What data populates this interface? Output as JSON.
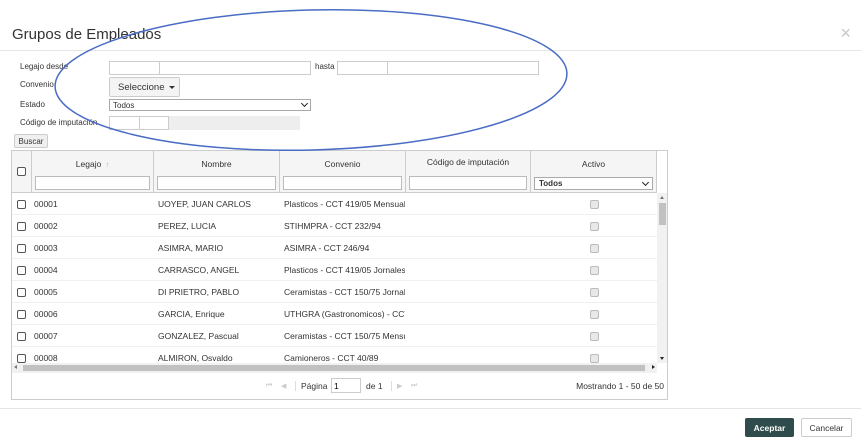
{
  "dialog": {
    "title": "Grupos de Empleados",
    "close_glyph": "×"
  },
  "filters": {
    "legajo_desde_label": "Legajo desde",
    "hasta_label": "hasta",
    "convenio_label": "Convenio",
    "convenio_button": "Seleccione",
    "estado_label": "Estado",
    "estado_value": "Todos",
    "codigo_label": "Código de imputación",
    "codigo_separator": "-",
    "buscar_label": "Buscar"
  },
  "grid": {
    "columns": [
      {
        "label": "Legajo",
        "sort": "ascending"
      },
      {
        "label": "Nombre"
      },
      {
        "label": "Convenio"
      },
      {
        "label": "Código de imputación"
      },
      {
        "label": "Activo"
      }
    ],
    "activo_filter": "Todos",
    "sort_glyph": "↑",
    "rows": [
      {
        "legajo": "00001",
        "nombre": "UOYEP, JUAN CARLOS",
        "convenio": "Plasticos - CCT 419/05 Mensual",
        "activo": true
      },
      {
        "legajo": "00002",
        "nombre": "PEREZ, LUCIA",
        "convenio": "STIHMPRA - CCT 232/94",
        "activo": true
      },
      {
        "legajo": "00003",
        "nombre": "ASIMRA, MARIO",
        "convenio": "ASIMRA - CCT 246/94",
        "activo": true
      },
      {
        "legajo": "00004",
        "nombre": "CARRASCO, ANGEL",
        "convenio": "Plasticos - CCT 419/05 Jornales",
        "activo": true
      },
      {
        "legajo": "00005",
        "nombre": "DI PRIETRO, PABLO",
        "convenio": "Ceramistas - CCT 150/75 Jornal",
        "activo": true
      },
      {
        "legajo": "00006",
        "nombre": "GARCIA, Enrique",
        "convenio": "UTHGRA (Gastronomicos) - CCT",
        "activo": true
      },
      {
        "legajo": "00007",
        "nombre": "GONZALEZ, Pascual",
        "convenio": "Ceramistas - CCT 150/75 Mensu",
        "activo": true
      },
      {
        "legajo": "00008",
        "nombre": "ALMIRON, Osvaldo",
        "convenio": "Camioneros - CCT 40/89",
        "activo": true
      }
    ],
    "pager": {
      "page_label": "Página",
      "page_value": "1",
      "of_label": "de 1",
      "summary": "Mostrando 1 - 50 de 50",
      "first_glyph": "⏮",
      "prev_glyph": "◀",
      "next_glyph": "▶",
      "last_glyph": "⏭"
    }
  },
  "actions": {
    "accept": "Aceptar",
    "cancel": "Cancelar"
  },
  "colors": {
    "annotation": "#4a6cc4",
    "accept_bg": "#2f4b4b"
  }
}
